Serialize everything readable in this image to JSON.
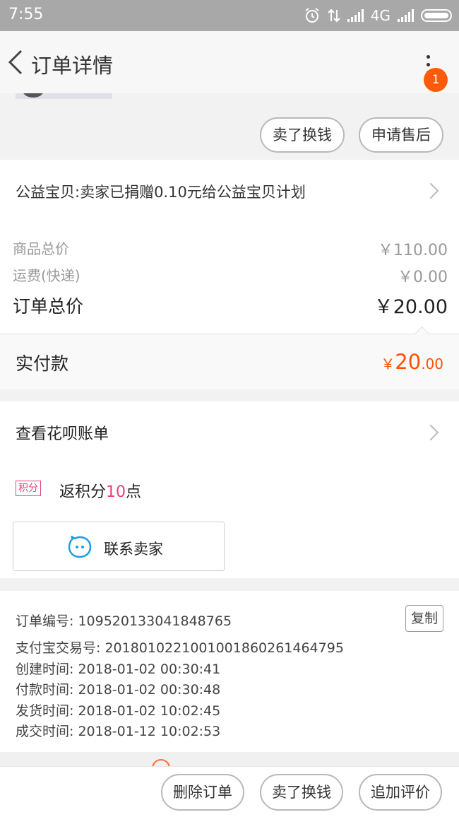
{
  "status_bar": {
    "time": "7:55",
    "network": "4G",
    "icons": [
      "alarm-icon",
      "data-arrows-icon",
      "signal-icon",
      "signal-icon",
      "battery-icon"
    ]
  },
  "header": {
    "title": "订单详情",
    "badge_count": "1"
  },
  "top_actions": {
    "sell_label": "卖了换钱",
    "after_sale_label": "申请售后"
  },
  "charity": {
    "text": "公益宝贝:卖家已捐赠0.10元给公益宝贝计划"
  },
  "price": {
    "goods_total_label": "商品总价",
    "goods_total_value": "￥110.00",
    "shipping_label": "运费(快递)",
    "shipping_value": "￥0.00",
    "order_total_label": "订单总价",
    "order_total_value": "￥20.00",
    "paid_label": "实付款",
    "paid_currency": "￥",
    "paid_int": "20",
    "paid_dec": ".00",
    "accent_color": "#ff5000"
  },
  "huabei": {
    "label": "查看花呗账单"
  },
  "points": {
    "tag": "积分",
    "prefix": "返积分",
    "count": "10",
    "suffix": "点"
  },
  "contact": {
    "label": "联系卖家"
  },
  "order_info": {
    "copy_label": "复制",
    "lines": [
      "订单编号: 109520133041848765",
      "支付宝交易号: 2018010221001001860261464795",
      "创建时间: 2018-01-02 00:30:41",
      "付款时间: 2018-01-02 00:30:48",
      "发货时间: 2018-01-02 10:02:45",
      "成交时间: 2018-01-12 10:02:53"
    ]
  },
  "bottom_bar": {
    "delete_label": "删除订单",
    "sell_label": "卖了换钱",
    "review_label": "追加评价"
  }
}
